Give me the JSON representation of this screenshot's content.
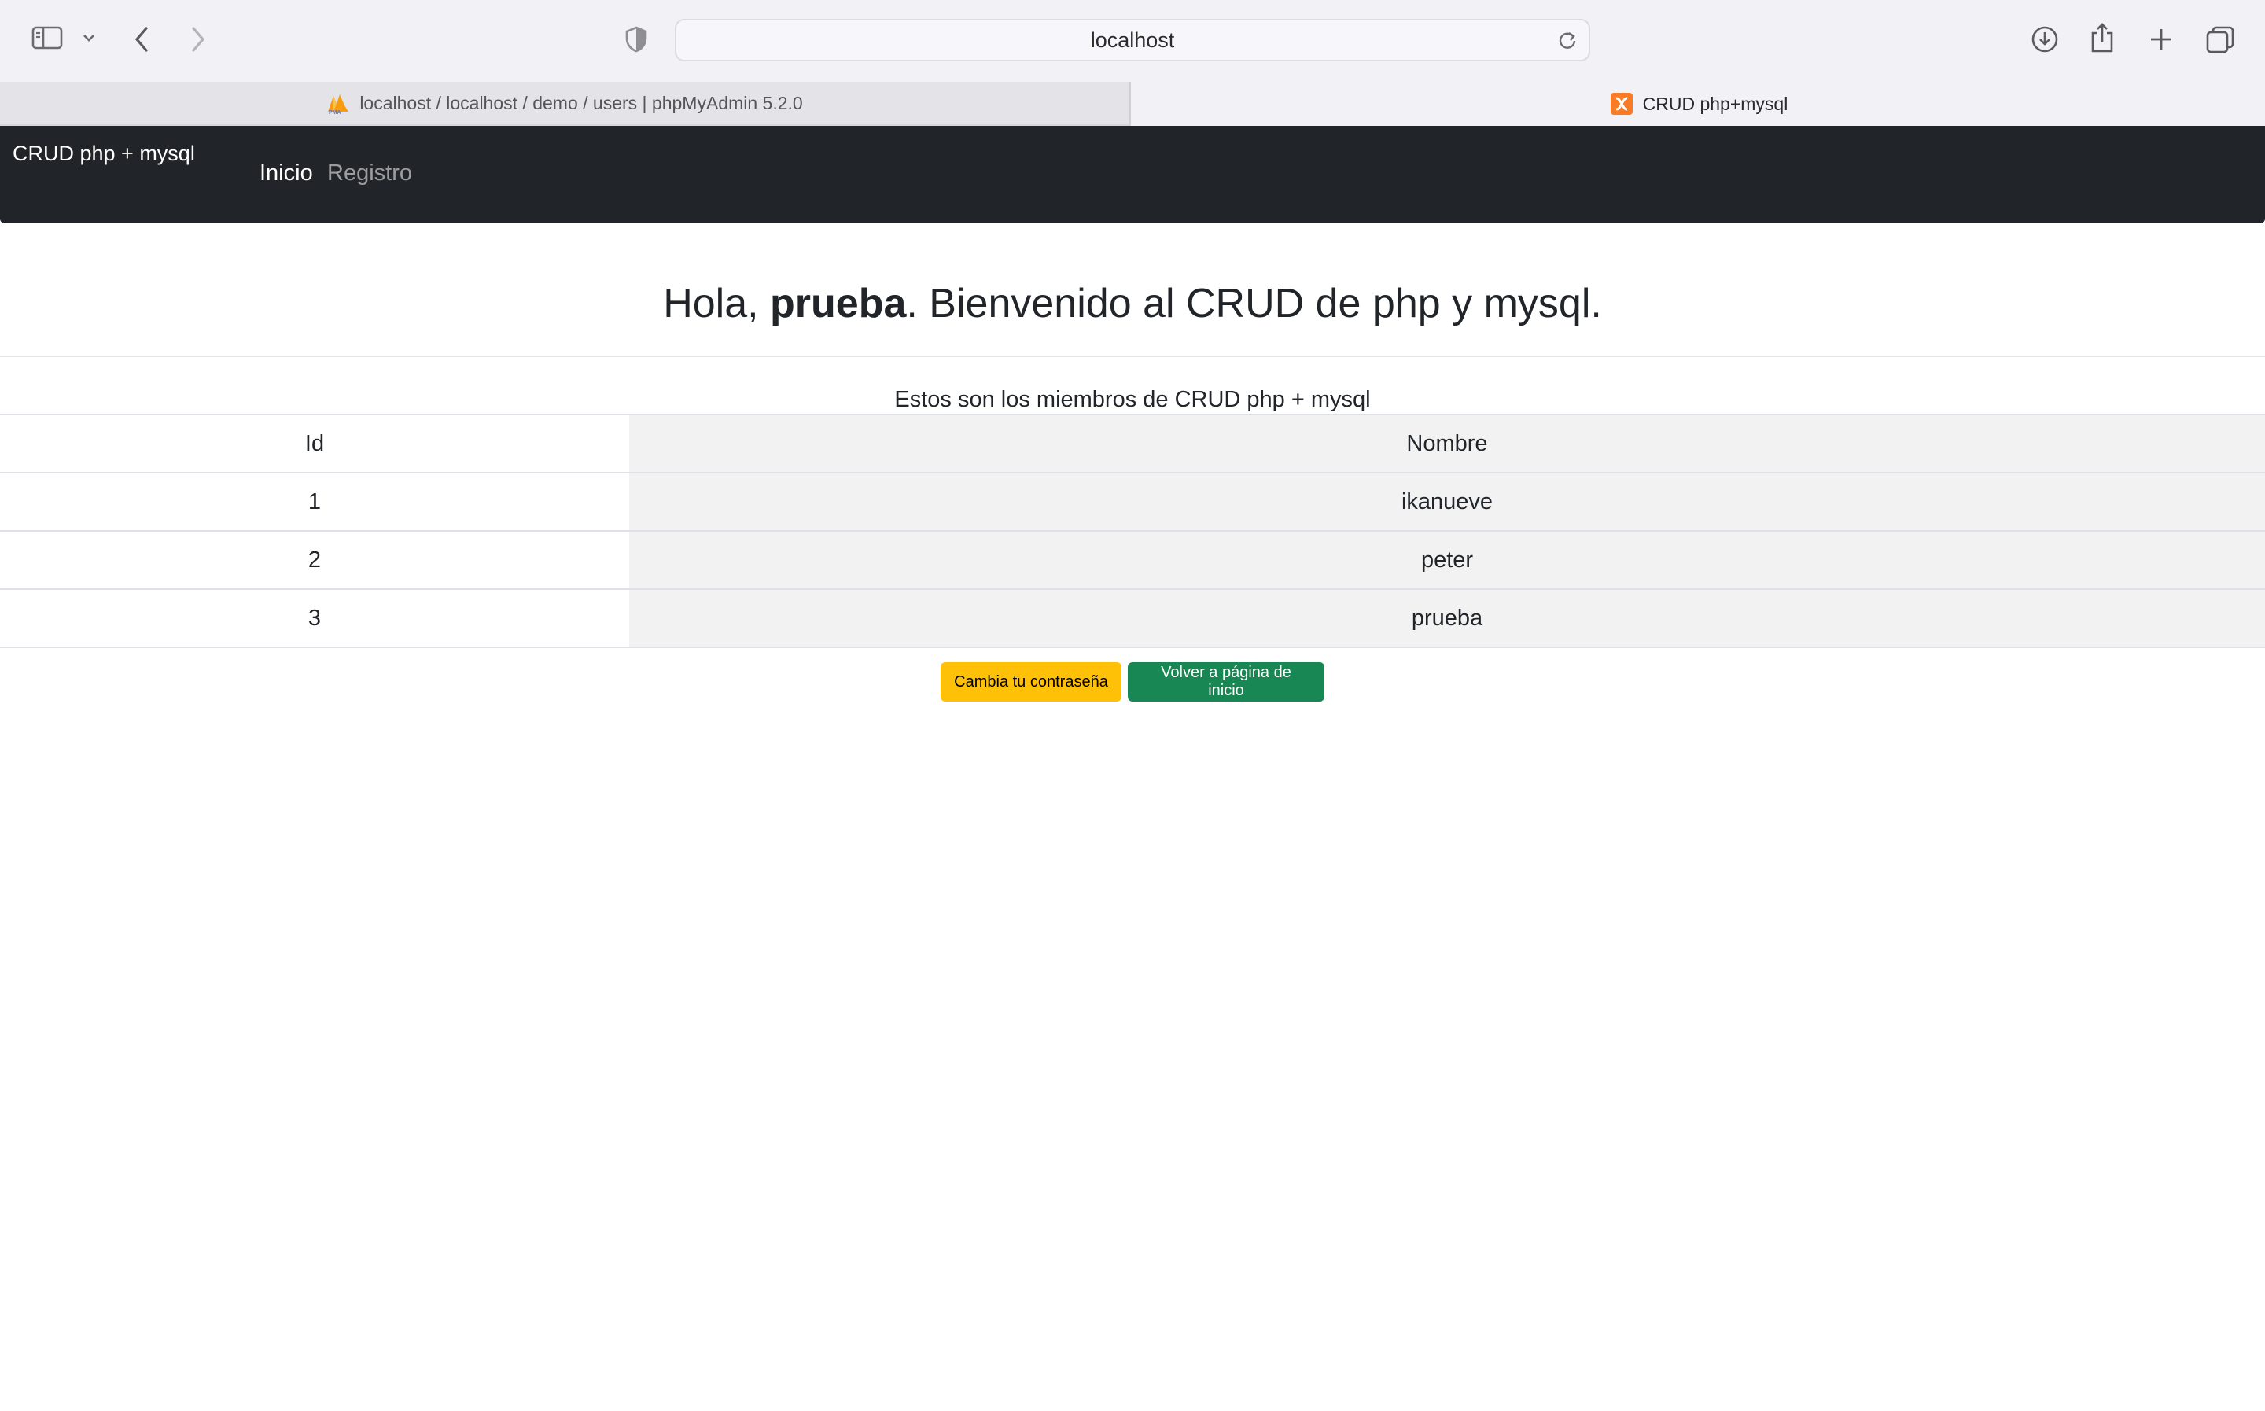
{
  "browser": {
    "url": "localhost",
    "tabs": [
      {
        "title": "localhost / localhost / demo / users | phpMyAdmin 5.2.0",
        "favicon": "phpmyadmin-icon",
        "active": false
      },
      {
        "title": "CRUD php+mysql",
        "favicon": "xampp-icon",
        "active": true
      }
    ],
    "icons": [
      "sidebar-icon",
      "chevron-down-icon",
      "back-icon",
      "forward-icon",
      "shield-icon",
      "reload-icon",
      "download-icon",
      "share-icon",
      "new-tab-icon",
      "tab-overview-icon"
    ]
  },
  "navbar": {
    "brand": "CRUD php + mysql",
    "links": [
      {
        "label": "Inicio",
        "active": true
      },
      {
        "label": "Registro",
        "active": false
      }
    ]
  },
  "main": {
    "heading": {
      "prefix": "Hola, ",
      "username": "prueba",
      "suffix": ". Bienvenido al CRUD de php y mysql."
    },
    "caption": "Estos son los miembros de CRUD php + mysql",
    "table": {
      "headers": [
        "Id",
        "Nombre"
      ],
      "rows": [
        {
          "id": "1",
          "name": "ikanueve"
        },
        {
          "id": "2",
          "name": "peter"
        },
        {
          "id": "3",
          "name": "prueba"
        }
      ]
    },
    "buttons": {
      "change_password": "Cambia tu contraseña",
      "back_home": "Volver a página de inicio"
    }
  },
  "colors": {
    "navbar_bg": "#212529",
    "warning": "#ffc107",
    "success": "#198754"
  }
}
